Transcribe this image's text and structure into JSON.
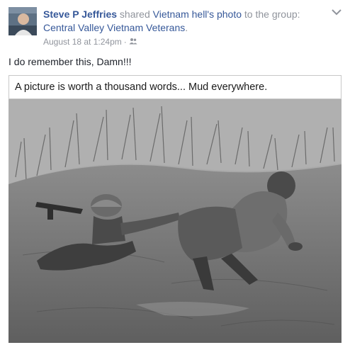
{
  "post": {
    "author": "Steve P Jeffries",
    "shared_text": " shared ",
    "source_page": "Vietnam hell",
    "photo_suffix": "'s photo",
    "to_group_text": " to the group: ",
    "group_name": "Central Valley Vietnam Veterans",
    "group_suffix": ".",
    "timestamp": "August 18 at 1:24pm",
    "separator": "·",
    "body_text": "I do remember this, Damn!!!",
    "privacy_icon": "group-icon",
    "menu_icon": "chevron-down-icon"
  },
  "photo": {
    "caption": "A picture is worth a thousand words... Mud everywhere."
  },
  "colors": {
    "link": "#365899",
    "meta": "#90949c",
    "text": "#1d2129"
  }
}
